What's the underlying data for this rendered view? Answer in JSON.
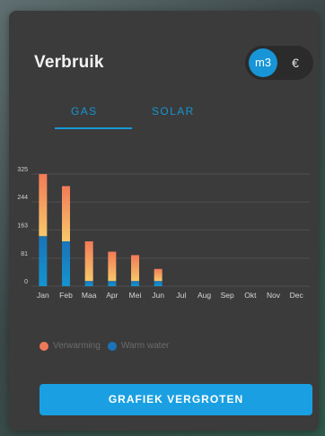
{
  "header": {
    "title": "Verbruik",
    "unit_toggle": {
      "options": [
        "m3",
        "€"
      ],
      "selected": "m3"
    }
  },
  "tabs": [
    {
      "label": "GAS",
      "active": true
    },
    {
      "label": "SOLAR",
      "active": false
    }
  ],
  "chart_data": {
    "type": "bar",
    "stacked": true,
    "categories": [
      "Jan",
      "Feb",
      "Maa",
      "Apr",
      "Mei",
      "Jun",
      "Jul",
      "Aug",
      "Sep",
      "Okt",
      "Nov",
      "Dec"
    ],
    "yticks": [
      0,
      81,
      163,
      244,
      325
    ],
    "ylim": [
      0,
      325
    ],
    "series": [
      {
        "name": "Warm water",
        "color_top": "#1a73b8",
        "values": [
          145,
          130,
          15,
          15,
          15,
          15,
          0,
          0,
          0,
          0,
          0,
          0
        ]
      },
      {
        "name": "Verwarming",
        "color_top": "#f07a58",
        "values": [
          180,
          160,
          115,
          85,
          75,
          35,
          0,
          0,
          0,
          0,
          0,
          0
        ]
      }
    ],
    "grid": true,
    "legend_position": "bottom-left"
  },
  "legend": [
    {
      "label": "Verwarming",
      "color": "#f07a58"
    },
    {
      "label": "Warm water",
      "color": "#1a73b8"
    }
  ],
  "cta": {
    "label": "GRAFIEK VERGROTEN"
  },
  "colors": {
    "accent": "#1798d9",
    "card": "#3b3b3b"
  }
}
